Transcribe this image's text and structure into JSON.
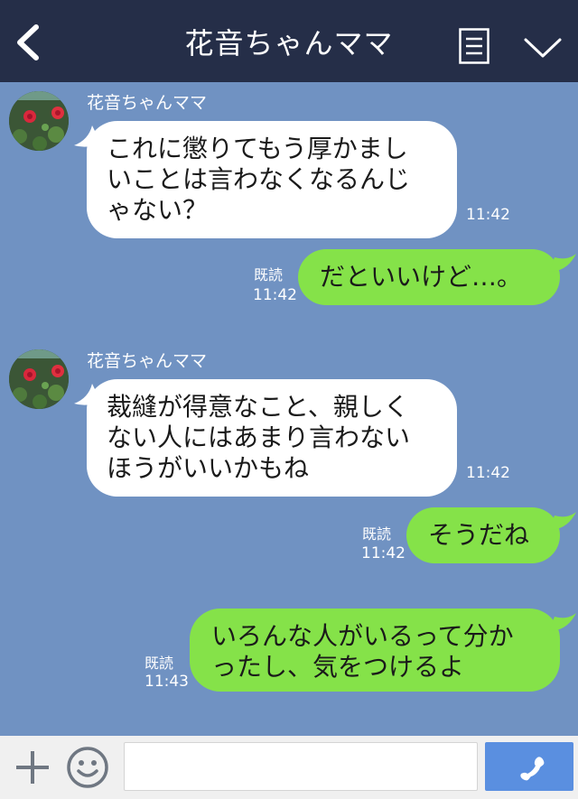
{
  "header": {
    "title": "花音ちゃんママ",
    "back_icon": "chevron-left-icon",
    "menu_icon": "list-icon",
    "expand_icon": "chevron-down-icon"
  },
  "messages": [
    {
      "direction": "incoming",
      "sender": "花音ちゃんママ",
      "lines": [
        "これに懲りてもう厚かまし",
        "いことは言わなくなるんじ",
        "ゃない？"
      ],
      "time": "11:42"
    },
    {
      "direction": "outgoing",
      "lines": [
        "だといいけど…。"
      ],
      "read": "既読",
      "time": "11:42"
    },
    {
      "direction": "incoming",
      "sender": "花音ちゃんママ",
      "lines": [
        "裁縫が得意なこと、親しく",
        "ない人にはあまり言わない",
        "ほうがいいかもね"
      ],
      "time": "11:42"
    },
    {
      "direction": "outgoing",
      "lines": [
        "そうだね"
      ],
      "read": "既読",
      "time": "11:42"
    },
    {
      "direction": "outgoing",
      "lines": [
        "いろんな人がいるって分か",
        "ったし、気をつけるよ"
      ],
      "read": "既読",
      "time": "11:43"
    }
  ],
  "footer": {
    "plus_icon": "plus-icon",
    "emoji_icon": "smiley-icon",
    "input_value": "",
    "call_icon": "phone-icon"
  },
  "colors": {
    "header_bg": "#252e48",
    "chat_bg": "#7092c2",
    "incoming_bubble": "#ffffff",
    "outgoing_bubble": "#85e249",
    "call_button": "#5a8fe0"
  }
}
